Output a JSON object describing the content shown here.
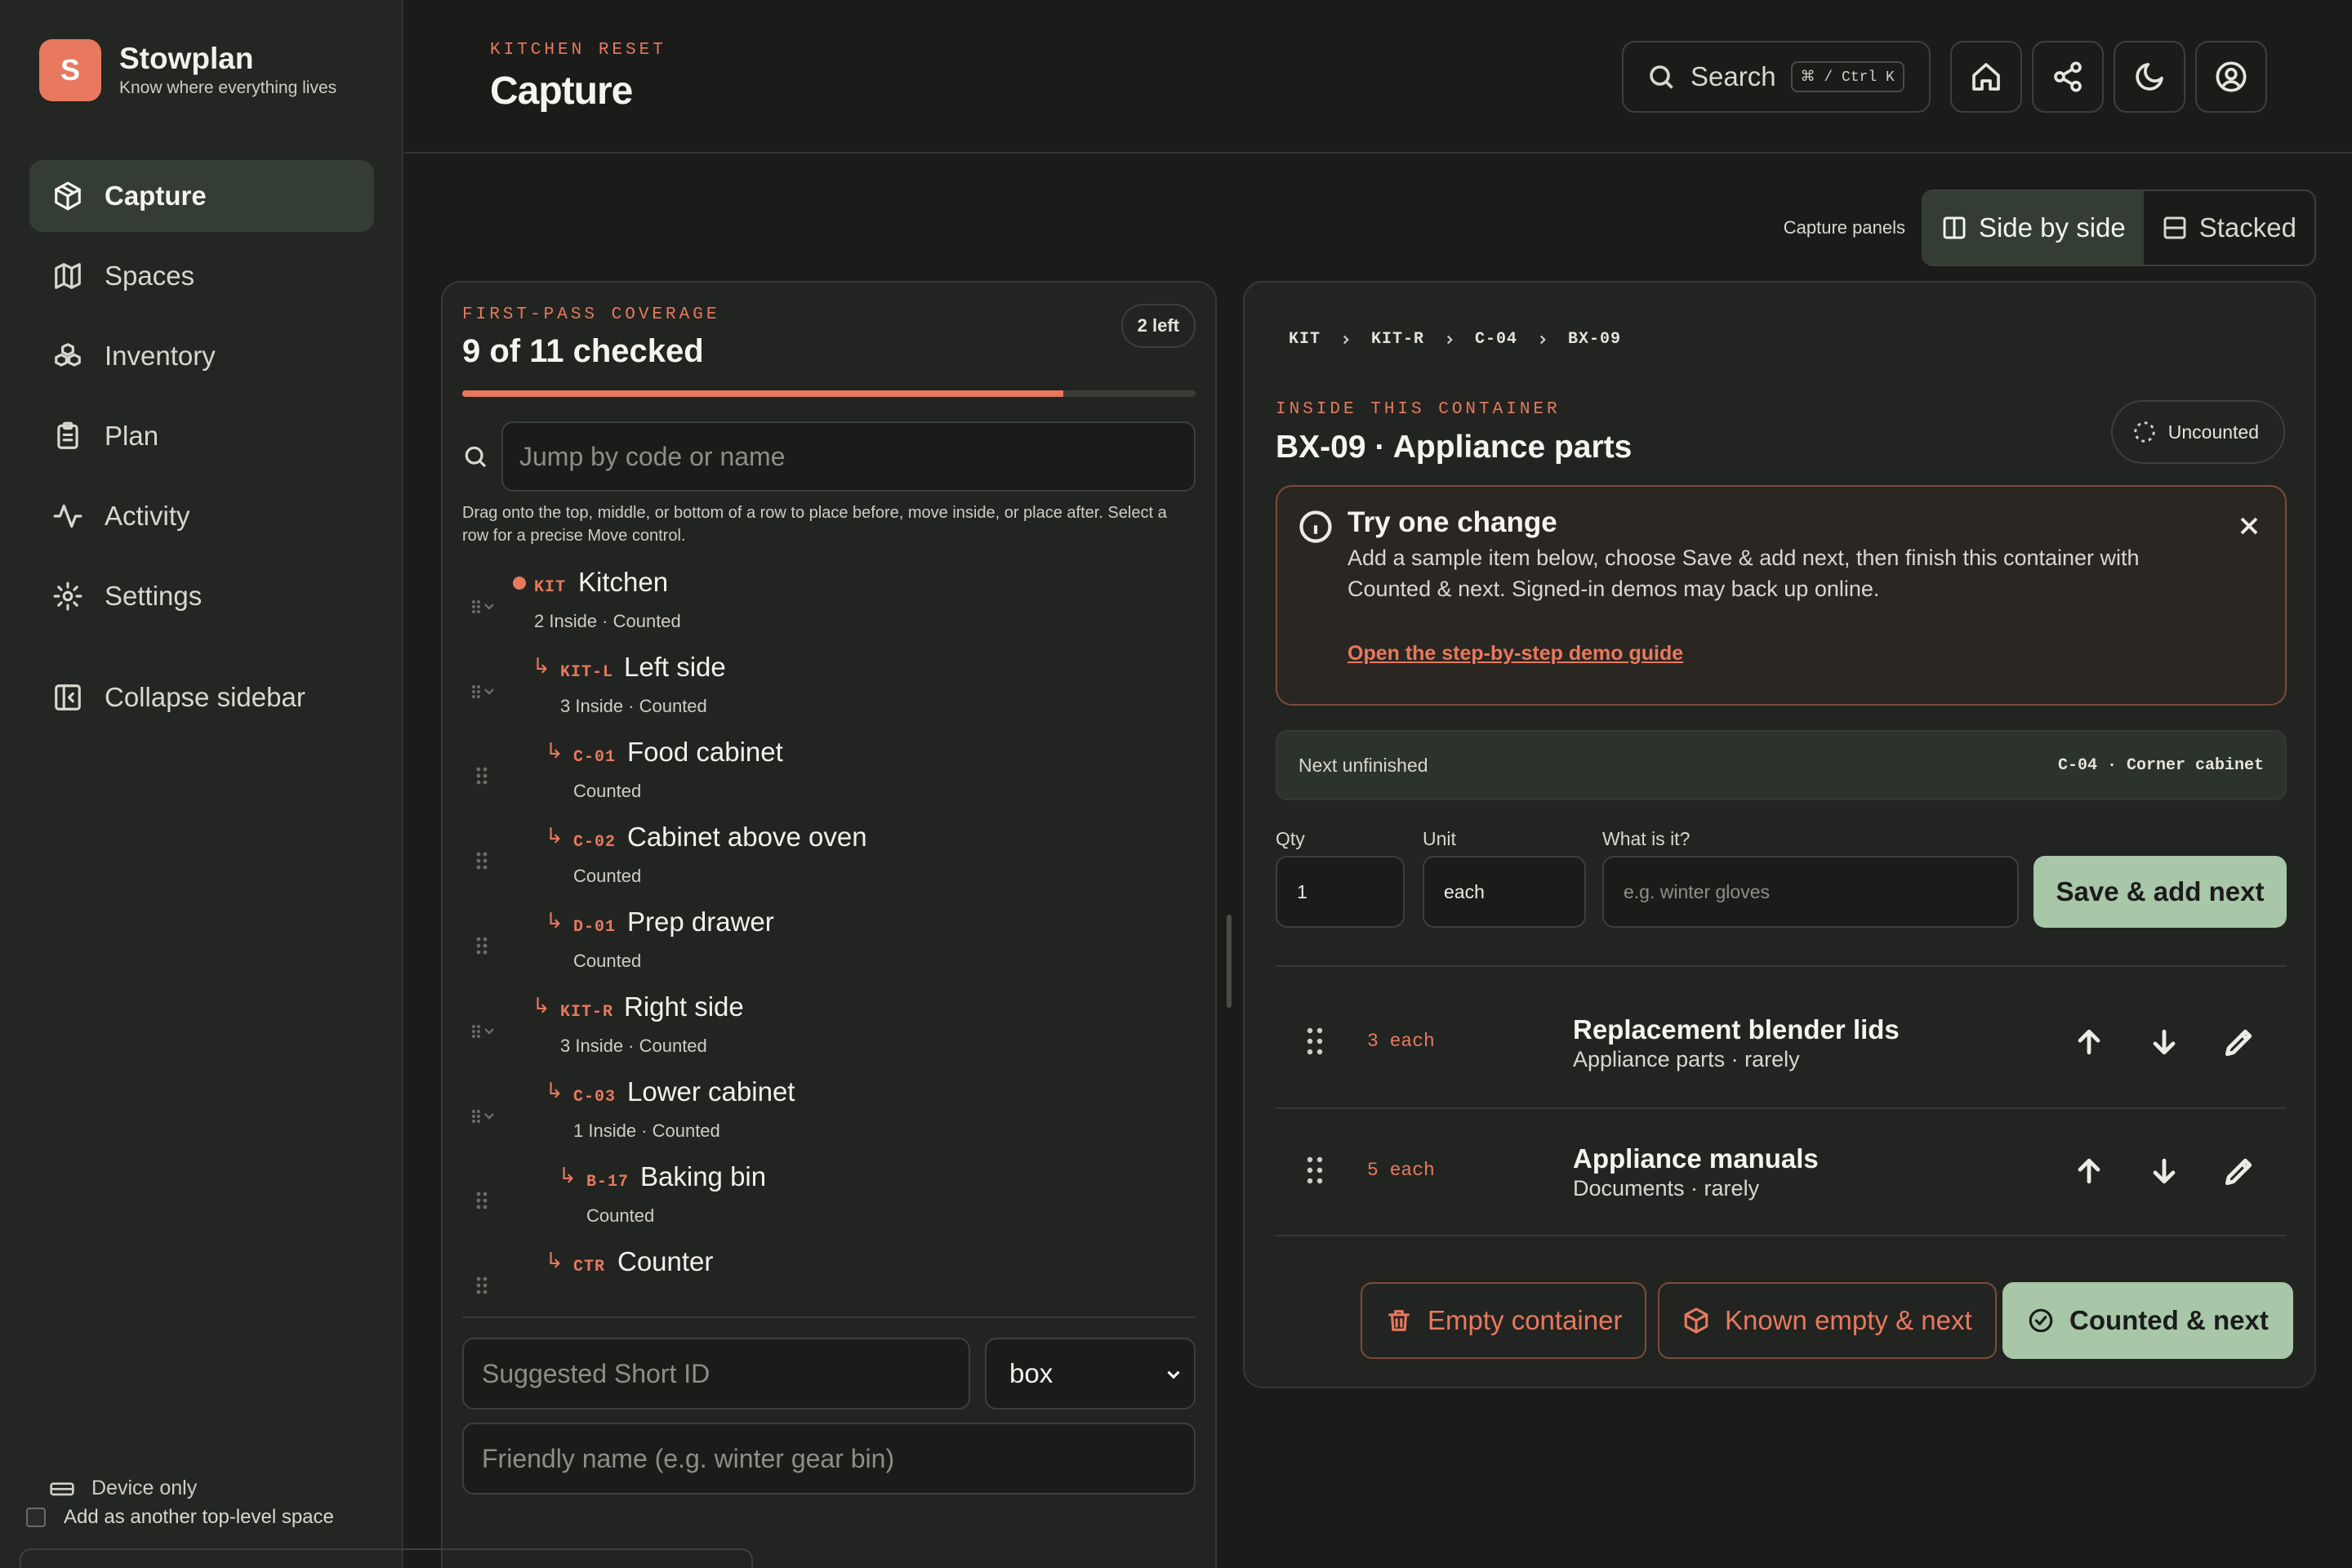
{
  "app": {
    "name": "Stowplan",
    "tagline": "Know where everything lives",
    "logo_letter": "S"
  },
  "sidebar": {
    "items": [
      {
        "label": "Capture",
        "icon": "package-icon",
        "active": true
      },
      {
        "label": "Spaces",
        "icon": "map-icon",
        "active": false
      },
      {
        "label": "Inventory",
        "icon": "boxes-icon",
        "active": false
      },
      {
        "label": "Plan",
        "icon": "clipboard-icon",
        "active": false
      },
      {
        "label": "Activity",
        "icon": "activity-icon",
        "active": false
      },
      {
        "label": "Settings",
        "icon": "gear-icon",
        "active": false
      }
    ],
    "collapse_label": "Collapse sidebar",
    "device_label": "Device only"
  },
  "header": {
    "eyebrow": "KITCHEN RESET",
    "title": "Capture",
    "search_label": "Search",
    "search_shortcut": "⌘ / Ctrl K"
  },
  "panels_toggle": {
    "label": "Capture panels",
    "options": [
      "Side by side",
      "Stacked"
    ],
    "selected": "Side by side"
  },
  "coverage": {
    "eyebrow": "FIRST-PASS COVERAGE",
    "title": "9 of 11 checked",
    "left_badge": "2 left",
    "progress": 0.82,
    "jump_placeholder": "Jump by code or name",
    "hint": "Drag onto the top, middle, or bottom of a row to place before, move inside, or place after. Select a row for a precise Move control.",
    "tree": [
      {
        "code": "KIT",
        "name": "Kitchen",
        "meta": "2 Inside · Counted",
        "depth": 0,
        "current": true,
        "expandable": true
      },
      {
        "code": "KIT-L",
        "name": "Left side",
        "meta": "3 Inside · Counted",
        "depth": 1,
        "expandable": true
      },
      {
        "code": "C-01",
        "name": "Food cabinet",
        "meta": "Counted",
        "depth": 2,
        "expandable": false
      },
      {
        "code": "C-02",
        "name": "Cabinet above oven",
        "meta": "Counted",
        "depth": 2,
        "expandable": false
      },
      {
        "code": "D-01",
        "name": "Prep drawer",
        "meta": "Counted",
        "depth": 2,
        "expandable": false
      },
      {
        "code": "KIT-R",
        "name": "Right side",
        "meta": "3 Inside · Counted",
        "depth": 1,
        "expandable": true
      },
      {
        "code": "C-03",
        "name": "Lower cabinet",
        "meta": "1 Inside · Counted",
        "depth": 2,
        "expandable": true
      },
      {
        "code": "B-17",
        "name": "Baking bin",
        "meta": "Counted",
        "depth": 3,
        "expandable": false
      },
      {
        "code": "CTR",
        "name": "Counter",
        "meta": "",
        "depth": 2,
        "expandable": false
      }
    ],
    "short_id_placeholder": "Suggested Short ID",
    "type_value": "box",
    "friendly_placeholder": "Friendly name (e.g. winter gear bin)",
    "top_level_label": "Add as another top-level space"
  },
  "container": {
    "breadcrumb": [
      "KIT",
      "KIT-R",
      "C-04",
      "BX-09"
    ],
    "eyebrow": "INSIDE THIS CONTAINER",
    "title": "BX-09 · Appliance parts",
    "status": "Uncounted",
    "tip": {
      "title": "Try one change",
      "body": "Add a sample item below, choose Save & add next, then finish this container with Counted & next. Signed-in demos may back up online.",
      "link": "Open the step-by-step demo guide"
    },
    "next_unfinished_label": "Next unfinished",
    "next_unfinished_value": "C-04 · Corner cabinet",
    "form": {
      "qty_label": "Qty",
      "qty_value": "1",
      "unit_label": "Unit",
      "unit_value": "each",
      "what_label": "What is it?",
      "what_placeholder": "e.g. winter gloves",
      "save_label": "Save & add next"
    },
    "items": [
      {
        "qty": "3 each",
        "name": "Replacement blender lids",
        "meta": "Appliance parts · rarely"
      },
      {
        "qty": "5 each",
        "name": "Appliance manuals",
        "meta": "Documents · rarely"
      }
    ],
    "actions": {
      "empty_label": "Empty container",
      "known_empty_label": "Known empty & next",
      "counted_label": "Counted & next"
    }
  },
  "colors": {
    "accent": "#e8795e",
    "primary_button": "#a8c6a8",
    "background": "#1b1c1a",
    "sidebar": "#232622"
  }
}
